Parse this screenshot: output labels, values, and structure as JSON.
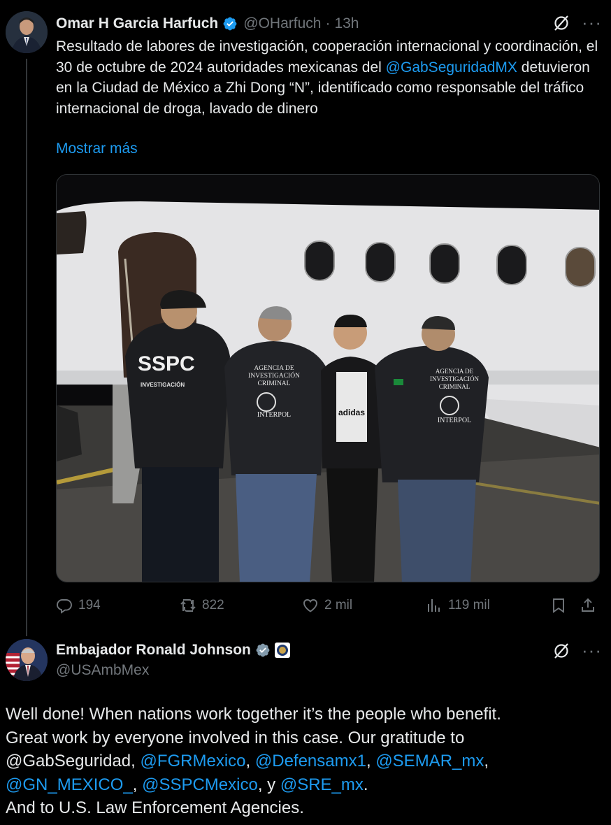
{
  "tweet1": {
    "author_name": "Omar H Garcia Harfuch",
    "handle": "@OHarfuch",
    "separator": "·",
    "time": "13h",
    "text_part1": "Resultado de labores de investigación, cooperación internacional y coordinación, el 30 de octubre de 2024 autoridades mexicanas del ",
    "mention": "@GabSeguridadMX",
    "text_part2": " detuvieron en la Ciudad de México a Zhi Dong “N”, identificado como responsable del tráfico internacional de droga, lavado de dinero",
    "show_more": "Mostrar más",
    "photo": {
      "sign_sspc": "SSPC",
      "sign_investigacion": "INVESTIGACIÓN",
      "jacket_text_1": "AGENCIA DE\nINVESTIGACIÓN\nCRIMINAL",
      "jacket_text_1b": "INTERPOL",
      "jacket_text_2": "AGENCIA DE\nINVESTIGACIÓN\nCRIMINAL",
      "jacket_text_2b": "INTERPOL",
      "shirt_text": "adidas"
    },
    "stats": {
      "replies": "194",
      "reposts": "822",
      "likes": "2 mil",
      "views": "119 mil"
    }
  },
  "tweet2": {
    "author_name": "Embajador Ronald Johnson",
    "handle": "@USAmbMex",
    "line1": "Well done!  When nations work together it’s the people who benefit.",
    "line2": "Great work by everyone involved in this case.  Our gratitude to",
    "line3_a": "@GabSeguridad, ",
    "line3_m1": "@FGRMexico",
    "line3_sep1": ", ",
    "line3_m2": "@Defensamx1",
    "line3_sep2": ", ",
    "line3_m3": "@SEMAR_mx",
    "line3_end": ",",
    "line4_m1": "@GN_MEXICO_",
    "line4_sep1": ", ",
    "line4_m2": "@SSPCMexico",
    "line4_sep2": ", y ",
    "line4_m3": "@SRE_mx",
    "line4_end": ".",
    "line5": "And to U.S. Law Enforcement Agencies."
  },
  "colors": {
    "background": "#000000",
    "text": "#e7e9ea",
    "muted": "#71767b",
    "link": "#1d9bf0",
    "verified": "#1d9bf0"
  }
}
